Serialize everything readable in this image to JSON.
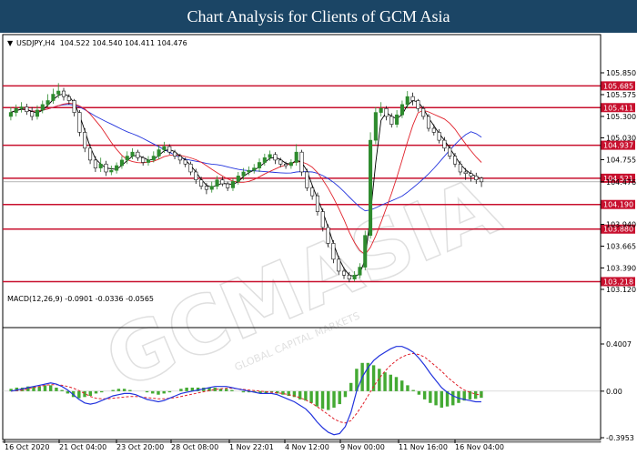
{
  "header": {
    "title": "Chart Analysis for Clients of GCM Asia"
  },
  "colors": {
    "header_bg": "#1b4565",
    "level_line": "#c8102e",
    "level_tag": "#c8102e",
    "bull": "#2e8b2e",
    "bear": "#111111",
    "ma_fast": "#000000",
    "ma_mid": "#e0202a",
    "ma_slow": "#2233dd",
    "macd_hist": "#44aa33",
    "macd_signal": "#e0202a",
    "macd_line": "#2233dd"
  },
  "watermark": {
    "text": "GCMASIA",
    "subtext": "GLOBAL CAPITAL MARKETS"
  },
  "chart_data": [
    {
      "type": "candlestick",
      "title": "USDJPY,H4  104.522 104.540 104.411 104.476",
      "ylim": [
        103.12,
        105.85
      ],
      "y_ticks": [
        "105.850",
        "105.575",
        "105.300",
        "105.030",
        "104.755",
        "104.476",
        "103.940",
        "103.665",
        "103.390",
        "103.120"
      ],
      "levels": [
        105.685,
        105.411,
        104.937,
        104.521,
        104.19,
        103.88,
        103.218
      ],
      "level_labels": [
        "105.685",
        "105.411",
        "104.937",
        "104.521",
        "104.190",
        "103.880",
        "103.218"
      ],
      "current_price": 104.476,
      "x_labels": [
        "16 Oct 2020",
        "21 Oct 04:00",
        "23 Oct 20:00",
        "28 Oct 08:00",
        "1 Nov 22:01",
        "4 Nov 12:00",
        "9 Nov 00:00",
        "11 Nov 16:00",
        "16 Nov 04:00"
      ],
      "close": [
        105.35,
        105.4,
        105.42,
        105.36,
        105.3,
        105.38,
        105.45,
        105.5,
        105.58,
        105.62,
        105.55,
        105.5,
        105.35,
        105.1,
        104.9,
        104.75,
        104.65,
        104.7,
        104.6,
        104.62,
        104.68,
        104.75,
        104.8,
        104.85,
        104.78,
        104.72,
        104.75,
        104.8,
        104.88,
        104.92,
        104.85,
        104.8,
        104.75,
        104.7,
        104.6,
        104.5,
        104.42,
        104.38,
        104.42,
        104.5,
        104.45,
        104.4,
        104.48,
        104.55,
        104.6,
        104.62,
        104.65,
        104.72,
        104.78,
        104.82,
        104.75,
        104.7,
        104.68,
        104.72,
        104.85,
        104.6,
        104.4,
        104.3,
        104.1,
        103.9,
        103.7,
        103.5,
        103.35,
        103.3,
        103.25,
        103.3,
        103.4,
        103.8,
        105.0,
        105.35,
        105.4,
        105.3,
        105.2,
        105.32,
        105.45,
        105.55,
        105.5,
        105.4,
        105.3,
        105.15,
        105.1,
        105.0,
        104.9,
        104.8,
        104.7,
        104.6,
        104.58,
        104.55,
        104.5,
        104.476
      ],
      "open": [
        105.3,
        105.35,
        105.4,
        105.42,
        105.36,
        105.3,
        105.38,
        105.45,
        105.5,
        105.58,
        105.62,
        105.55,
        105.5,
        105.35,
        105.1,
        104.9,
        104.75,
        104.65,
        104.7,
        104.6,
        104.62,
        104.68,
        104.75,
        104.8,
        104.85,
        104.78,
        104.72,
        104.75,
        104.8,
        104.88,
        104.92,
        104.85,
        104.8,
        104.75,
        104.7,
        104.6,
        104.5,
        104.42,
        104.38,
        104.42,
        104.5,
        104.45,
        104.4,
        104.48,
        104.55,
        104.6,
        104.62,
        104.65,
        104.72,
        104.78,
        104.82,
        104.75,
        104.7,
        104.68,
        104.72,
        104.85,
        104.6,
        104.4,
        104.3,
        104.1,
        103.9,
        103.7,
        103.5,
        103.35,
        103.3,
        103.25,
        103.3,
        103.4,
        103.8,
        105.0,
        105.35,
        105.4,
        105.3,
        105.2,
        105.32,
        105.45,
        105.55,
        105.5,
        105.4,
        105.3,
        105.15,
        105.1,
        105.0,
        104.9,
        104.8,
        104.7,
        104.6,
        104.58,
        104.55,
        104.522
      ],
      "high": [
        105.42,
        105.45,
        105.48,
        105.46,
        105.42,
        105.44,
        105.5,
        105.58,
        105.65,
        105.72,
        105.66,
        105.58,
        105.52,
        105.38,
        105.15,
        104.95,
        104.8,
        104.78,
        104.74,
        104.68,
        104.72,
        104.8,
        104.86,
        104.9,
        104.88,
        104.8,
        104.8,
        104.86,
        104.94,
        104.98,
        104.95,
        104.88,
        104.83,
        104.78,
        104.73,
        104.64,
        104.54,
        104.46,
        104.48,
        104.55,
        104.54,
        104.48,
        104.52,
        104.6,
        104.65,
        104.67,
        104.7,
        104.77,
        104.83,
        104.87,
        104.85,
        104.78,
        104.73,
        104.76,
        104.95,
        104.88,
        104.64,
        104.44,
        104.34,
        104.14,
        103.94,
        103.74,
        103.54,
        103.4,
        103.34,
        103.35,
        103.45,
        103.86,
        105.1,
        105.42,
        105.48,
        105.43,
        105.34,
        105.38,
        105.5,
        105.62,
        105.6,
        105.52,
        105.43,
        105.33,
        105.2,
        105.14,
        105.04,
        104.94,
        104.84,
        104.74,
        104.65,
        104.62,
        104.59,
        104.54
      ],
      "low": [
        105.25,
        105.3,
        105.35,
        105.32,
        105.25,
        105.26,
        105.34,
        105.42,
        105.46,
        105.53,
        105.5,
        105.45,
        105.3,
        105.05,
        104.85,
        104.7,
        104.6,
        104.6,
        104.55,
        104.56,
        104.58,
        104.64,
        104.7,
        104.76,
        104.74,
        104.68,
        104.68,
        104.72,
        104.76,
        104.84,
        104.82,
        104.76,
        104.7,
        104.66,
        104.56,
        104.45,
        104.38,
        104.32,
        104.34,
        104.38,
        104.42,
        104.36,
        104.36,
        104.44,
        104.5,
        104.56,
        104.58,
        104.6,
        104.68,
        104.74,
        104.7,
        104.66,
        104.64,
        104.64,
        104.68,
        104.55,
        104.36,
        104.25,
        104.05,
        103.85,
        103.65,
        103.45,
        103.3,
        103.25,
        103.21,
        103.22,
        103.26,
        103.36,
        103.76,
        104.95,
        105.3,
        105.25,
        105.16,
        105.16,
        105.28,
        105.4,
        105.44,
        105.36,
        105.26,
        105.11,
        105.06,
        104.96,
        104.86,
        104.76,
        104.66,
        104.56,
        104.5,
        104.48,
        104.45,
        104.411
      ]
    },
    {
      "type": "macd",
      "title": "MACD(12,26,9) -0.0901 -0.0336 -0.0565",
      "ylim": [
        -0.3953,
        0.4007
      ],
      "y_ticks": [
        "0.4007",
        "0.00",
        "-0.3953"
      ],
      "macd": [
        0.0,
        0.01,
        0.02,
        0.03,
        0.04,
        0.05,
        0.06,
        0.07,
        0.06,
        0.04,
        0.01,
        -0.03,
        -0.07,
        -0.1,
        -0.11,
        -0.1,
        -0.08,
        -0.06,
        -0.04,
        -0.03,
        -0.02,
        -0.02,
        -0.03,
        -0.05,
        -0.07,
        -0.08,
        -0.09,
        -0.08,
        -0.06,
        -0.04,
        -0.02,
        -0.01,
        0.0,
        0.01,
        0.02,
        0.03,
        0.04,
        0.04,
        0.04,
        0.03,
        0.02,
        0.01,
        0.0,
        -0.01,
        -0.02,
        -0.02,
        -0.02,
        -0.03,
        -0.05,
        -0.07,
        -0.09,
        -0.12,
        -0.15,
        -0.2,
        -0.26,
        -0.31,
        -0.35,
        -0.37,
        -0.36,
        -0.3,
        -0.18,
        0.0,
        0.12,
        0.2,
        0.26,
        0.3,
        0.33,
        0.36,
        0.38,
        0.38,
        0.36,
        0.33,
        0.28,
        0.22,
        0.15,
        0.09,
        0.03,
        -0.01,
        -0.04,
        -0.06,
        -0.07,
        -0.08,
        -0.09,
        -0.0901
      ],
      "signal": [
        0.0,
        0.005,
        0.01,
        0.02,
        0.03,
        0.04,
        0.05,
        0.055,
        0.055,
        0.05,
        0.04,
        0.025,
        0.005,
        -0.02,
        -0.045,
        -0.06,
        -0.065,
        -0.065,
        -0.06,
        -0.055,
        -0.05,
        -0.045,
        -0.045,
        -0.05,
        -0.055,
        -0.06,
        -0.065,
        -0.065,
        -0.06,
        -0.055,
        -0.045,
        -0.035,
        -0.025,
        -0.015,
        -0.005,
        0.005,
        0.015,
        0.02,
        0.025,
        0.025,
        0.02,
        0.015,
        0.01,
        0.005,
        0.0,
        -0.005,
        -0.01,
        -0.015,
        -0.02,
        -0.03,
        -0.04,
        -0.055,
        -0.075,
        -0.1,
        -0.13,
        -0.165,
        -0.2,
        -0.235,
        -0.26,
        -0.27,
        -0.25,
        -0.19,
        -0.12,
        -0.04,
        0.04,
        0.11,
        0.17,
        0.22,
        0.26,
        0.29,
        0.31,
        0.32,
        0.31,
        0.29,
        0.25,
        0.21,
        0.17,
        0.12,
        0.08,
        0.04,
        0.01,
        -0.01,
        -0.025,
        -0.0336
      ],
      "histogram": [
        0.02,
        0.03,
        0.03,
        0.04,
        0.04,
        0.04,
        0.05,
        0.05,
        0.03,
        0.01,
        -0.02,
        -0.05,
        -0.06,
        -0.05,
        -0.04,
        -0.02,
        -0.01,
        0.0,
        0.01,
        0.02,
        0.02,
        0.01,
        0.0,
        0.0,
        -0.01,
        -0.02,
        -0.03,
        -0.02,
        -0.01,
        0.0,
        0.02,
        0.03,
        0.03,
        0.03,
        0.03,
        0.03,
        0.03,
        0.02,
        0.02,
        0.01,
        0.0,
        -0.01,
        -0.01,
        -0.01,
        -0.02,
        -0.02,
        -0.01,
        -0.02,
        -0.03,
        -0.04,
        -0.05,
        -0.07,
        -0.08,
        -0.1,
        -0.13,
        -0.15,
        -0.16,
        -0.14,
        -0.11,
        -0.05,
        0.07,
        0.19,
        0.24,
        0.24,
        0.22,
        0.19,
        0.16,
        0.14,
        0.12,
        0.09,
        0.05,
        0.01,
        -0.03,
        -0.07,
        -0.1,
        -0.12,
        -0.14,
        -0.13,
        -0.12,
        -0.1,
        -0.08,
        -0.07,
        -0.065,
        -0.0565
      ]
    }
  ]
}
